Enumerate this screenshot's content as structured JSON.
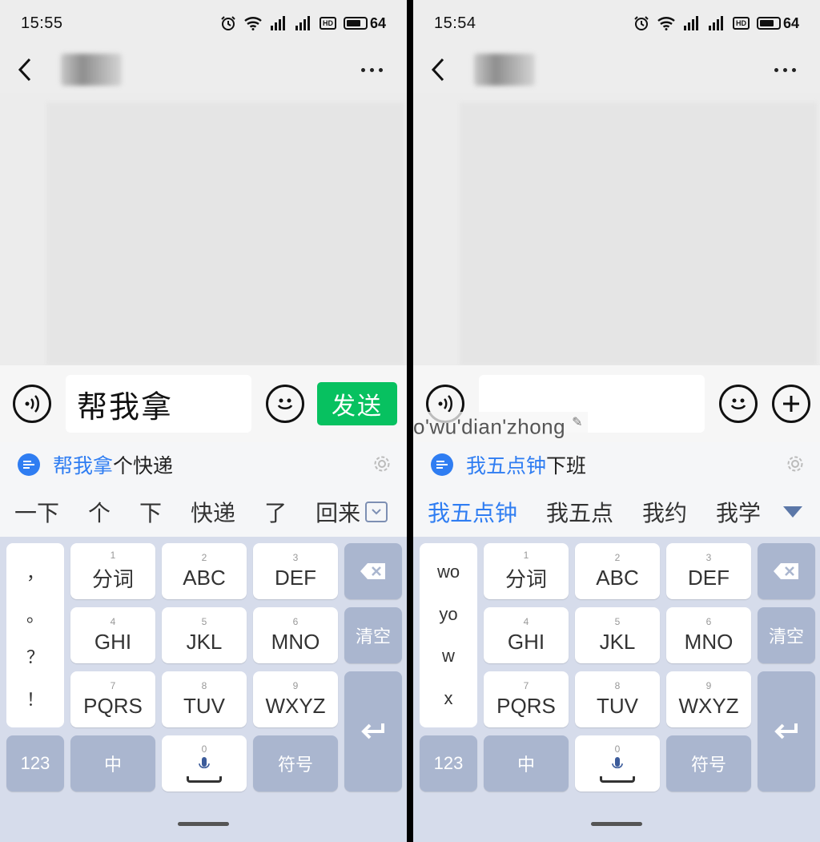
{
  "left": {
    "status": {
      "time": "15:55",
      "battery": "64"
    },
    "input_text": "帮我拿",
    "send_label": "发送",
    "suggestion": {
      "highlight": "帮我拿",
      "rest": "个快递"
    },
    "candidates": [
      "一下",
      "个",
      "下",
      "快递",
      "了",
      "回来"
    ],
    "side_keys": [
      "，",
      "。",
      "？",
      "！"
    ]
  },
  "right": {
    "status": {
      "time": "15:54",
      "battery": "64"
    },
    "input_text": "",
    "pinyin": "o'wu'dian'zhong",
    "suggestion": {
      "highlight": "我五点钟",
      "rest": "下班"
    },
    "candidates": [
      "我五点钟",
      "我五点",
      "我约",
      "我学"
    ],
    "side_keys": [
      "wo",
      "yo",
      "w",
      "x"
    ]
  },
  "keys": {
    "k1": {
      "num": "1",
      "label": "分词"
    },
    "k2": {
      "num": "2",
      "label": "ABC"
    },
    "k3": {
      "num": "3",
      "label": "DEF"
    },
    "k4": {
      "num": "4",
      "label": "GHI"
    },
    "k5": {
      "num": "5",
      "label": "JKL"
    },
    "k6": {
      "num": "6",
      "label": "MNO"
    },
    "k7": {
      "num": "7",
      "label": "PQRS"
    },
    "k8": {
      "num": "8",
      "label": "TUV"
    },
    "k9": {
      "num": "9",
      "label": "WXYZ"
    },
    "k0": {
      "num": "0"
    },
    "clear": "清空",
    "num_mode": "123",
    "lang": "中",
    "symbols": "符号"
  },
  "colors": {
    "accent": "#2f7df2",
    "send_green": "#07c160",
    "func_key": "#aab6cf"
  },
  "icons": {
    "status": [
      "alarm-icon",
      "wifi-icon",
      "signal-icon",
      "hd-icon",
      "battery-icon"
    ],
    "nav": [
      "back-arrow-icon",
      "more-dots-icon"
    ],
    "input": [
      "voice-icon",
      "emoji-icon",
      "plus-icon"
    ],
    "keyboard": [
      "backspace-icon",
      "enter-icon",
      "mic-icon",
      "settings-gear-icon",
      "ai-assist-icon"
    ]
  }
}
